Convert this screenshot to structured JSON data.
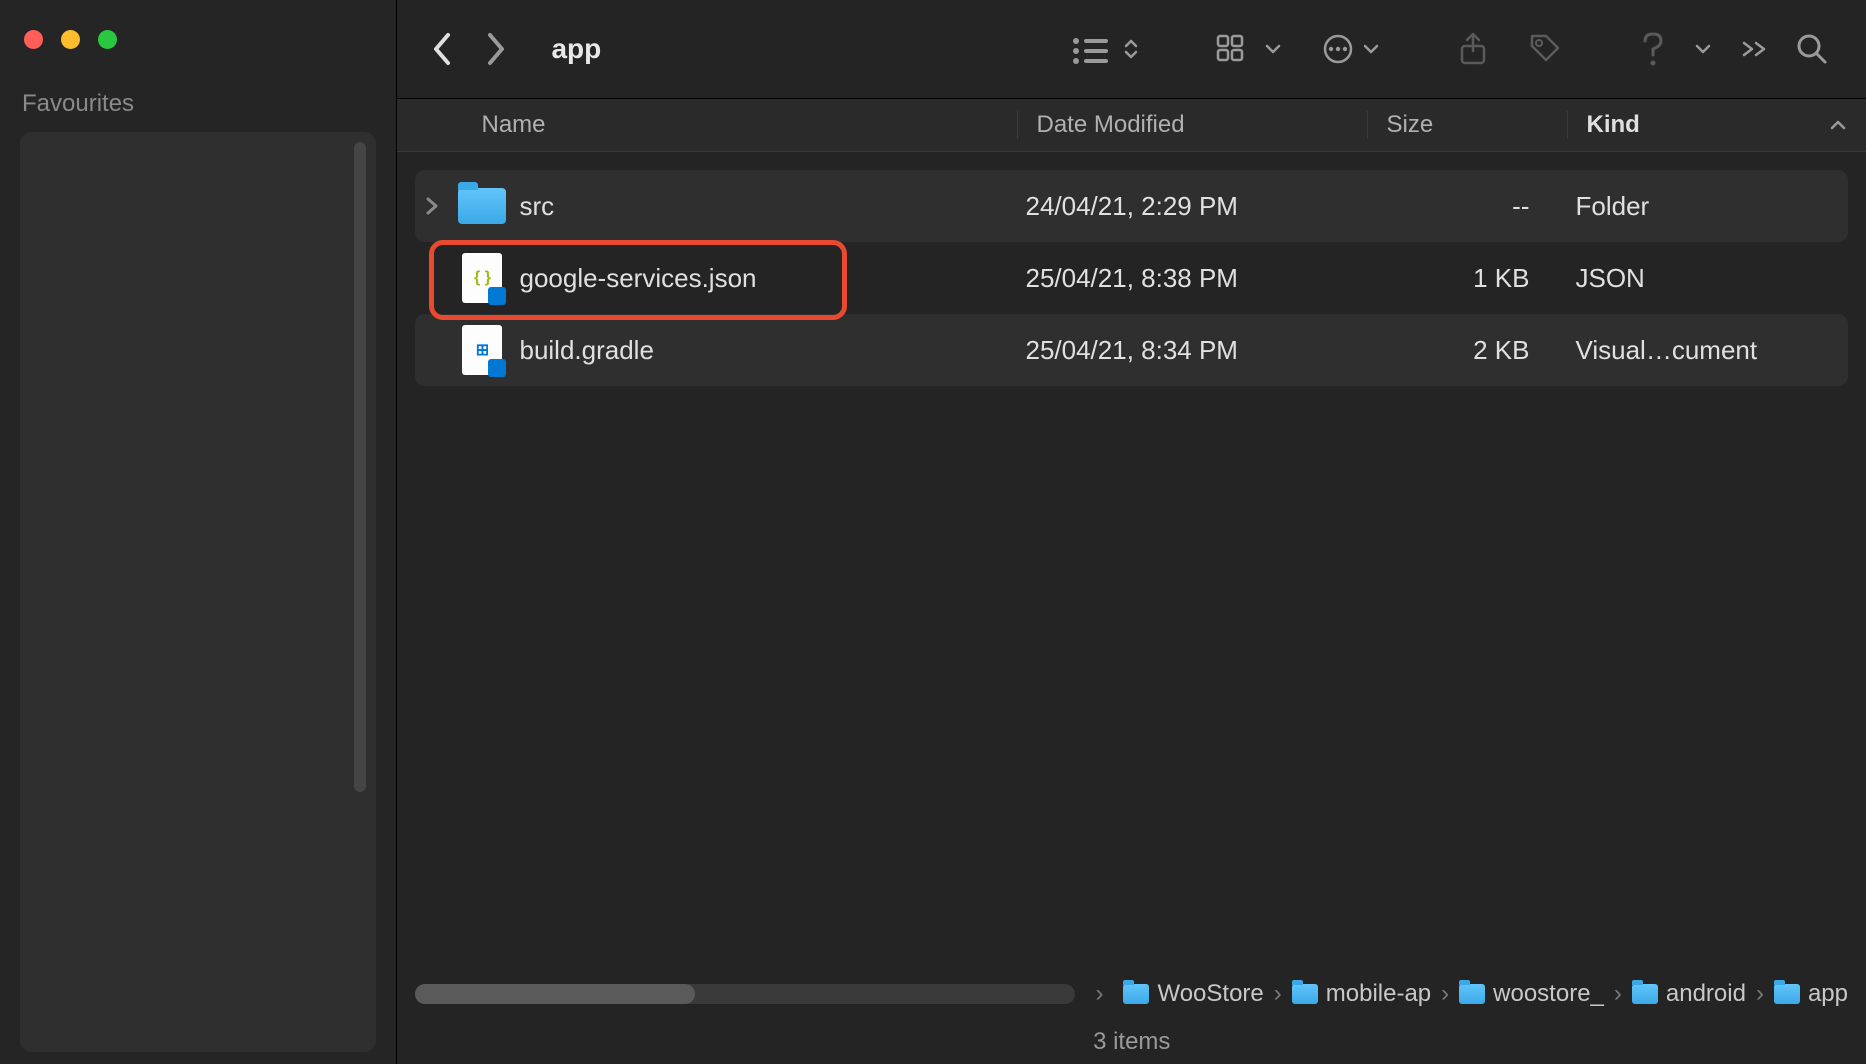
{
  "window": {
    "title": "app"
  },
  "sidebar": {
    "favourites_label": "Favourites"
  },
  "columns": {
    "name": "Name",
    "date": "Date Modified",
    "size": "Size",
    "kind": "Kind"
  },
  "files": [
    {
      "name": "src",
      "date": "24/04/21, 2:29 PM",
      "size": "--",
      "kind": "Folder",
      "type": "folder",
      "expandable": true
    },
    {
      "name": "google-services.json",
      "date": "25/04/21, 8:38 PM",
      "size": "1 KB",
      "kind": "JSON",
      "type": "json",
      "highlighted": true
    },
    {
      "name": "build.gradle",
      "date": "25/04/21, 8:34 PM",
      "size": "2 KB",
      "kind": "Visual…cument",
      "type": "gradle"
    }
  ],
  "path": [
    "WooStore",
    "mobile-app",
    "woostore_",
    "android",
    "app"
  ],
  "path_display": [
    "WooStore",
    "mobile-ap",
    "woostore_",
    "android",
    "app"
  ],
  "status": "3 items"
}
